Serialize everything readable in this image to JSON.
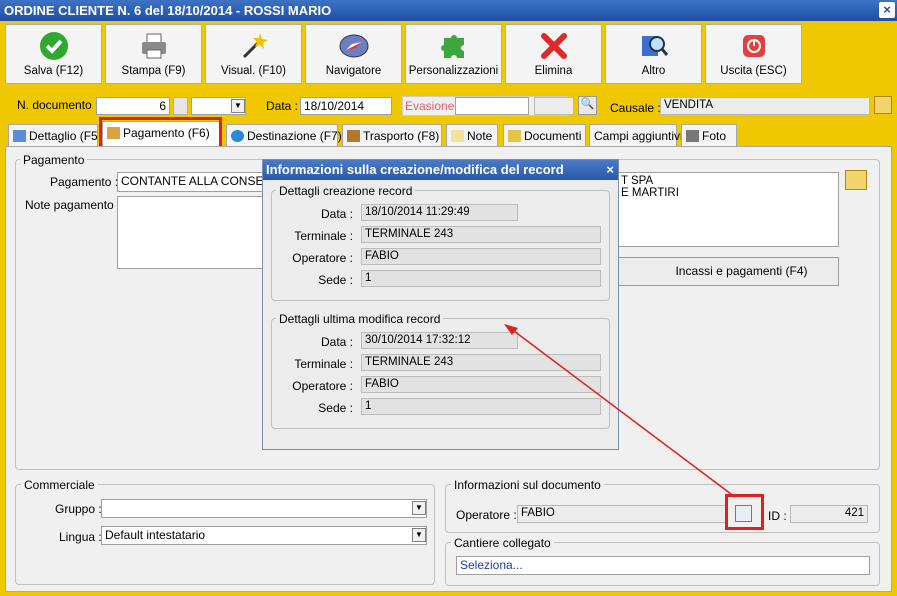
{
  "window": {
    "title": "ORDINE CLIENTE N. 6 del 18/10/2014 - ROSSI MARIO",
    "close_label": "×"
  },
  "toolbar": {
    "buttons": [
      {
        "label": "Salva (F12)",
        "icon": "check-icon"
      },
      {
        "label": "Stampa (F9)",
        "icon": "printer-icon"
      },
      {
        "label": "Visual. (F10)",
        "icon": "magic-wand-icon"
      },
      {
        "label": "Navigatore",
        "icon": "compass-icon"
      },
      {
        "label": "Personalizzazioni",
        "icon": "puzzle-icon"
      },
      {
        "label": "Elimina",
        "icon": "delete-x-icon"
      },
      {
        "label": "Altro",
        "icon": "magnifier-icon"
      },
      {
        "label": "Uscita (ESC)",
        "icon": "power-icon"
      }
    ]
  },
  "header": {
    "doc_number_label": "N. documento :",
    "doc_number": "6",
    "date_label": "Data :",
    "date": "18/10/2014",
    "evasione_label": "Evasione:",
    "evasione": "",
    "causale_label": "Causale :",
    "causale": "VENDITA"
  },
  "tabs": [
    {
      "label": "Dettaglio (F5",
      "icon": "calendar-icon"
    },
    {
      "label": "Pagamento (F6)",
      "icon": "payment-icon",
      "active": true
    },
    {
      "label": "Destinazione (F7)",
      "icon": "globe-icon"
    },
    {
      "label": "Trasporto (F8)",
      "icon": "truck-icon"
    },
    {
      "label": "Note",
      "icon": "note-icon"
    },
    {
      "label": "Documenti",
      "icon": "folder-icon"
    },
    {
      "label": "Campi aggiuntivi",
      "icon": ""
    },
    {
      "label": "Foto",
      "icon": "camera-icon"
    }
  ],
  "payment": {
    "group_title": "Pagamento",
    "payment_label": "Pagamento :",
    "payment_value": "CONTANTE ALLA CONSE",
    "notes_label": "Note pagamento :",
    "bank_line1": "T SPA",
    "bank_line2": "E MARTIRI",
    "incassi_button": "Incassi e pagamenti (F4)"
  },
  "commerciale": {
    "group_title": "Commerciale",
    "gruppo_label": "Gruppo :",
    "gruppo_value": "",
    "lingua_label": "Lingua :",
    "lingua_value": "Default intestatario"
  },
  "doc_info": {
    "group_title": "Informazioni sul documento",
    "operator_label": "Operatore :",
    "operator_value": "FABIO",
    "id_label": "ID :",
    "id_value": "421"
  },
  "cantiere": {
    "group_title": "Cantiere collegato",
    "value": "Seleziona..."
  },
  "dialog": {
    "title": "Informazioni sulla creazione/modifica del record",
    "close_label": "×",
    "creation": {
      "title": "Dettagli creazione record",
      "rows": [
        {
          "label": "Data :",
          "value": "18/10/2014 11:29:49"
        },
        {
          "label": "Terminale :",
          "value": "TERMINALE 243"
        },
        {
          "label": "Operatore :",
          "value": "FABIO"
        },
        {
          "label": "Sede :",
          "value": "1"
        }
      ]
    },
    "modification": {
      "title": "Dettagli ultima modifica record",
      "rows": [
        {
          "label": "Data :",
          "value": "30/10/2014 17:32:12"
        },
        {
          "label": "Terminale :",
          "value": "TERMINALE 243"
        },
        {
          "label": "Operatore :",
          "value": "FABIO"
        },
        {
          "label": "Sede :",
          "value": "1"
        }
      ]
    }
  },
  "colors": {
    "background": "#f0c800",
    "titlebar": "#2a5bb0",
    "highlight": "#e02020"
  }
}
